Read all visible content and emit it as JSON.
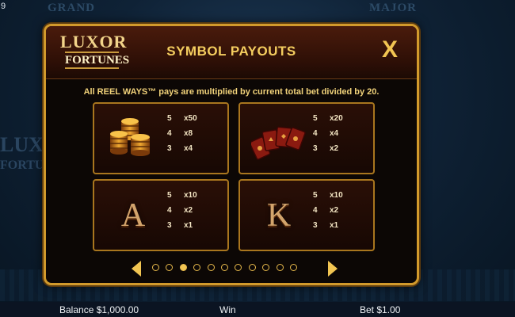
{
  "status": {
    "corner_value": "9"
  },
  "background": {
    "jackpot_left": "GRAND",
    "jackpot_right": "MAJOR",
    "logo_text_1": "LUXOR",
    "logo_text_2": "FORTUNES"
  },
  "panel": {
    "logo_line1": "LUXOR",
    "logo_line2": "FORTUNES",
    "title": "SYMBOL PAYOUTS",
    "close_label": "X",
    "subtitle": "All REEL WAYS™ pays are multiplied by current total bet divided by 20.",
    "cards": [
      {
        "symbol": "coin-stack-icon",
        "pays": [
          {
            "count": "5",
            "mult": "x50"
          },
          {
            "count": "4",
            "mult": "x8"
          },
          {
            "count": "3",
            "mult": "x4"
          }
        ]
      },
      {
        "symbol": "playing-cards-icon",
        "pays": [
          {
            "count": "5",
            "mult": "x20"
          },
          {
            "count": "4",
            "mult": "x4"
          },
          {
            "count": "3",
            "mult": "x2"
          }
        ]
      },
      {
        "symbol": "A",
        "pays": [
          {
            "count": "5",
            "mult": "x10"
          },
          {
            "count": "4",
            "mult": "x2"
          },
          {
            "count": "3",
            "mult": "x1"
          }
        ]
      },
      {
        "symbol": "K",
        "pays": [
          {
            "count": "5",
            "mult": "x10"
          },
          {
            "count": "4",
            "mult": "x2"
          },
          {
            "count": "3",
            "mult": "x1"
          }
        ]
      }
    ],
    "pager": {
      "total_pages": 11,
      "current_page": 3
    }
  },
  "footer": {
    "balance": "Balance $1,000.00",
    "win": "Win",
    "bet": "Bet $1.00"
  },
  "colors": {
    "gold": "#f2c552",
    "panel_border": "#d29a2c",
    "background": "#0b1a2a"
  }
}
